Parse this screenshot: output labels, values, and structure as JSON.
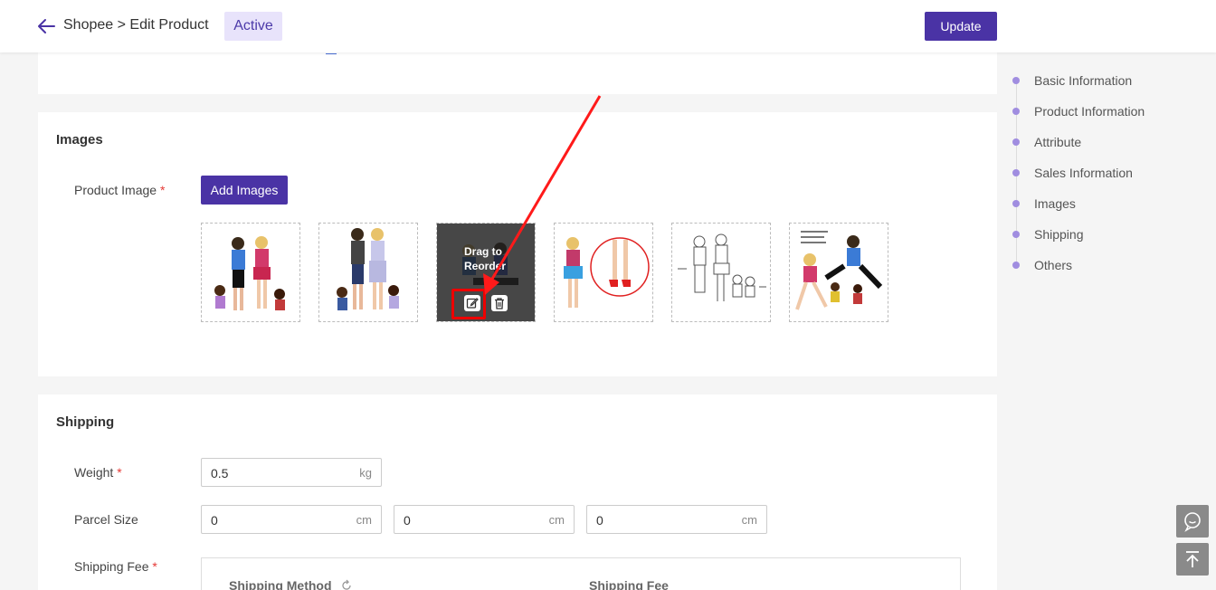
{
  "header": {
    "breadcrumb": "Shopee > Edit Product",
    "status_badge": "Active",
    "update_label": "Update"
  },
  "images_section": {
    "title": "Images",
    "product_image_label": "Product Image",
    "required_mark": "*",
    "add_images_label": "Add Images",
    "overlay_text": "Drag to Reorder",
    "thumbnails": [
      "doll-family-photo-1",
      "doll-family-photo-2",
      "doll-family-photo-3",
      "doll-closeup-shoes",
      "doll-family-sketch",
      "doll-family-sitting"
    ]
  },
  "shipping_section": {
    "title": "Shipping",
    "weight_label": "Weight",
    "weight_value": "0.5",
    "weight_unit": "kg",
    "parcel_label": "Parcel Size",
    "parcel_values": [
      "0",
      "0",
      "0"
    ],
    "parcel_unit": "cm",
    "fee_label": "Shipping Fee",
    "table_headers": [
      "Shipping Method",
      "Shipping Fee"
    ]
  },
  "sidenav": {
    "items": [
      "Basic Information",
      "Product Information",
      "Attribute",
      "Sales Information",
      "Images",
      "Shipping",
      "Others"
    ]
  },
  "colors": {
    "primary": "#4a33a5",
    "badge_bg": "#e8e3fb",
    "annotation": "#ff0000"
  }
}
